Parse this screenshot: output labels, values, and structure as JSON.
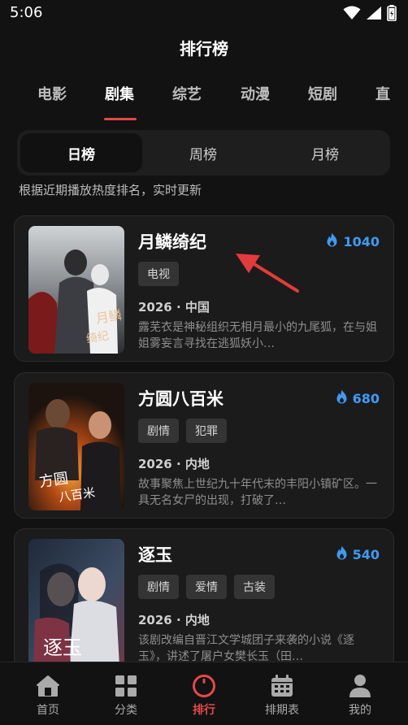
{
  "status_bar": {
    "time": "5:06",
    "icons": [
      "wifi-icon",
      "signal-icon",
      "battery-icon"
    ]
  },
  "header": {
    "title": "排行榜"
  },
  "category_tabs": [
    {
      "label": "电影",
      "active": false
    },
    {
      "label": "剧集",
      "active": true
    },
    {
      "label": "综艺",
      "active": false
    },
    {
      "label": "动漫",
      "active": false
    },
    {
      "label": "短剧",
      "active": false
    },
    {
      "label": "直",
      "active": false
    }
  ],
  "period_tabs": [
    {
      "label": "日榜",
      "active": true
    },
    {
      "label": "周榜",
      "active": false
    },
    {
      "label": "月榜",
      "active": false
    }
  ],
  "subtitle": "根据近期播放热度排名，实时更新",
  "items": [
    {
      "name": "月鳞绮纪",
      "heat": "1040",
      "tags": [
        "电视"
      ],
      "meta": "2026 · 中国",
      "desc": "露芜衣是神秘组织无相月最小的九尾狐，在与姐姐雾妄言寻找在逃狐妖小…",
      "poster_text": "月鳞绮纪"
    },
    {
      "name": "方圆八百米",
      "heat": "680",
      "tags": [
        "剧情",
        "犯罪"
      ],
      "meta": "2026 · 内地",
      "desc": "故事聚焦上世纪九十年代末的丰阳小镇矿区。一具无名女尸的出现，打破了…",
      "poster_text": "方圆八百米"
    },
    {
      "name": "逐玉",
      "heat": "540",
      "tags": [
        "剧情",
        "爱情",
        "古装"
      ],
      "meta": "2026 · 内地",
      "desc": "该剧改编自晋江文学城团子来袭的小说《逐玉》，讲述了屠户女樊长玉（田…",
      "poster_text": "逐玉"
    }
  ],
  "bottom_nav": [
    {
      "label": "首页",
      "icon": "home-icon",
      "active": false
    },
    {
      "label": "分类",
      "icon": "grid-icon",
      "active": false
    },
    {
      "label": "排行",
      "icon": "ranking-icon",
      "active": true
    },
    {
      "label": "排期表",
      "icon": "calendar-icon",
      "active": false
    },
    {
      "label": "我的",
      "icon": "user-icon",
      "active": false
    }
  ],
  "colors": {
    "accent": "#e54848",
    "heat": "#3d9bf5",
    "background": "#121212",
    "card": "#1b1b1b"
  }
}
